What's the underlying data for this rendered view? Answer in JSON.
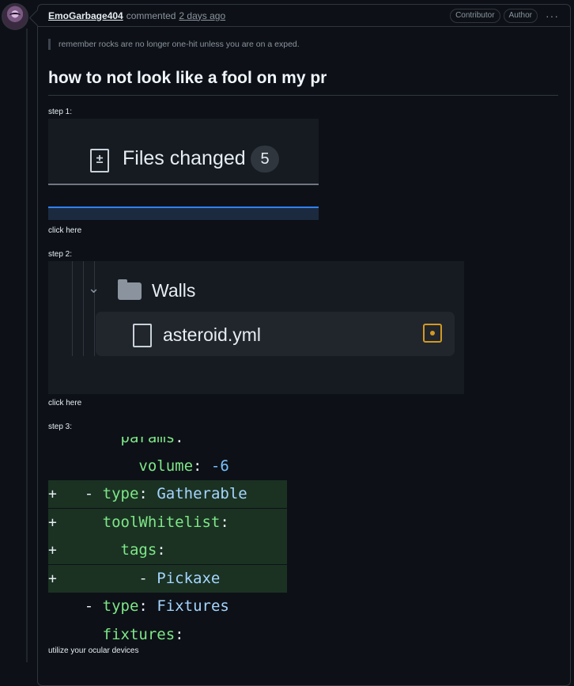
{
  "comment": {
    "author": "EmoGarbage404",
    "action": "commented",
    "time": "2 days ago",
    "badges": [
      "Contributor",
      "Author"
    ],
    "more_icon": "kebab-horizontal-icon"
  },
  "body": {
    "quote": "remember rocks are no longer one-hit unless you are on a exped.",
    "heading": "how to not look like a fool on my pr",
    "step1_label": "step 1:",
    "step1_caption": "click here",
    "step2_label": "step 2:",
    "step2_caption": "click here",
    "step3_label": "step 3:",
    "step3_caption": "utilize your ocular devices"
  },
  "screenshot1": {
    "tab_label": "Files changed",
    "tab_count": "5"
  },
  "screenshot2": {
    "folder_name": "Walls",
    "file_name": "asteroid.yml"
  },
  "screenshot3": {
    "lines": [
      {
        "indent": "      ",
        "key": "params",
        "sep": ":",
        "val": "",
        "added": false
      },
      {
        "indent": "        ",
        "key": "volume",
        "sep": ": ",
        "val": "-6",
        "added": false
      },
      {
        "indent": "  ",
        "dash": "- ",
        "key": "type",
        "sep": ": ",
        "val": "Gatherable",
        "added": true
      },
      {
        "indent": "    ",
        "key": "toolWhitelist",
        "sep": ":",
        "val": "",
        "added": true
      },
      {
        "indent": "      ",
        "key": "tags",
        "sep": ":",
        "val": "",
        "added": true
      },
      {
        "indent": "        ",
        "dash": "- ",
        "key": "",
        "sep": "",
        "val": "Pickaxe",
        "added": true
      },
      {
        "indent": "  ",
        "dash": "- ",
        "key": "type",
        "sep": ": ",
        "val": "Fixtures",
        "added": false
      },
      {
        "indent": "    ",
        "key": "fixtures",
        "sep": ":",
        "val": "",
        "added": false
      }
    ]
  }
}
